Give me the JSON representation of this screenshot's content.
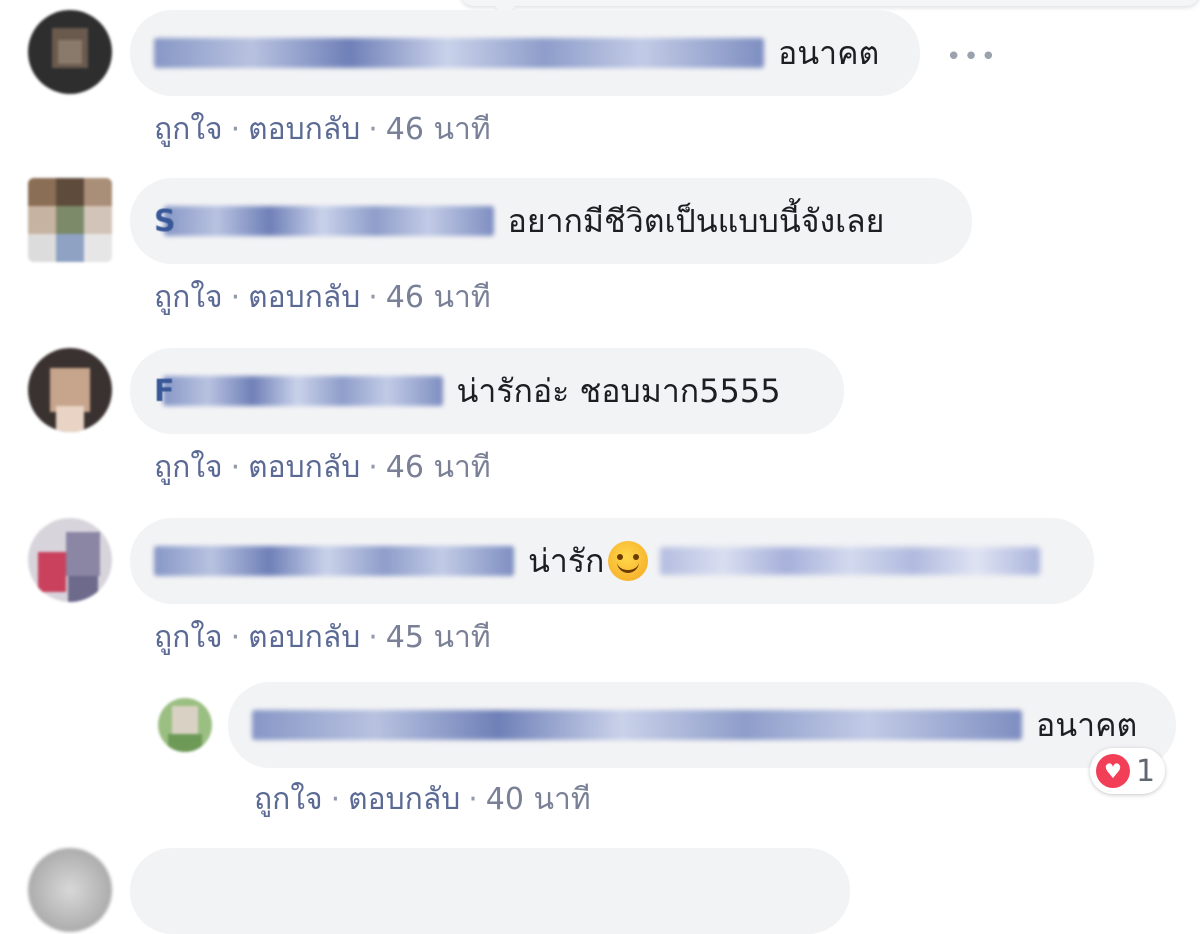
{
  "more_icon": "ellipsis-icon",
  "comments": [
    {
      "initial": "",
      "text": "อนาคต",
      "actions": {
        "like": "ถูกใจ",
        "reply": "ตอบกลับ",
        "time": "46 นาที"
      }
    },
    {
      "initial": "S",
      "text": "อยากมีชีวิตเป็นแบบนี้จังเลย",
      "actions": {
        "like": "ถูกใจ",
        "reply": "ตอบกลับ",
        "time": "46 นาที"
      }
    },
    {
      "initial": "F",
      "text": "น่ารักอ่ะ ชอบมาก5555",
      "actions": {
        "like": "ถูกใจ",
        "reply": "ตอบกลับ",
        "time": "46 นาที"
      }
    },
    {
      "initial": "",
      "text": "น่ารัก",
      "emoji": "smiling-face-emoji",
      "actions": {
        "like": "ถูกใจ",
        "reply": "ตอบกลับ",
        "time": "45 นาที"
      }
    },
    {
      "initial": "",
      "text": "อนาคต",
      "actions": {
        "like": "ถูกใจ",
        "reply": "ตอบกลับ",
        "time": "40 นาที"
      },
      "reaction": {
        "icon": "heart-icon",
        "count": "1"
      }
    }
  ]
}
